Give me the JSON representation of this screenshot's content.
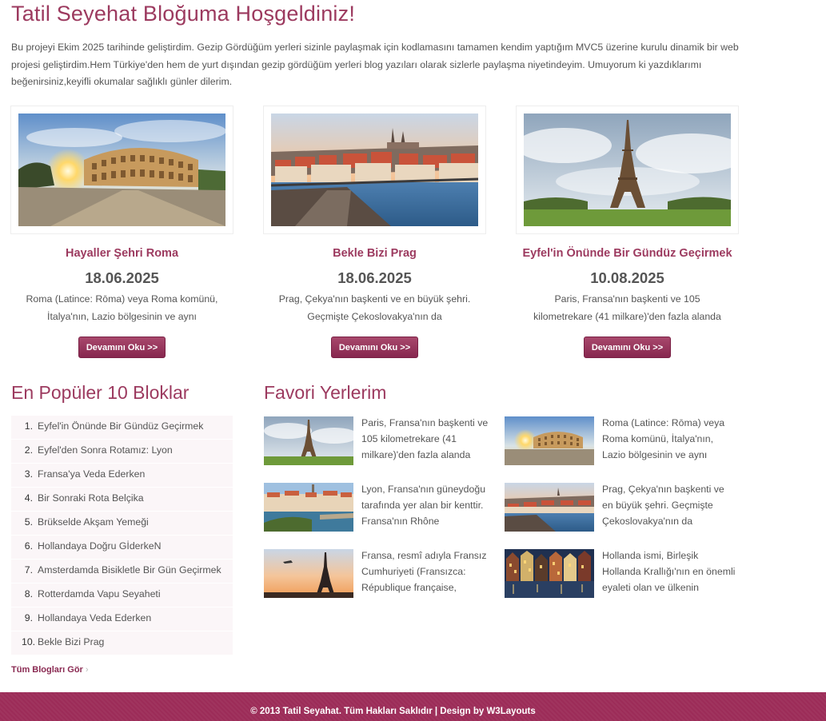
{
  "page": {
    "title": "Tatil Seyehat Bloğuma Hoşgeldiniz!",
    "intro": "Bu projeyi Ekim 2025 tarihinde geliştirdim. Gezip Gördüğüm yerleri sizinle paylaşmak için kodlamasını tamamen kendim yaptığım MVC5 üzerine kurulu dinamik bir web projesi geliştirdim.Hem Türkiye'den hem de yurt dışından gezip gördüğüm yerleri blog yazıları olarak sizlerle paylaşma niyetindeyim. Umuyorum ki yazdıklarımı beğenirsiniz,keyifli okumalar sağlıklı günler dilerim."
  },
  "featured": [
    {
      "title": "Hayaller Şehri Roma",
      "date": "18.06.2025",
      "excerpt": "Roma (Latince: Rōma) veya Roma komünü, İtalya'nın, Lazio bölgesinin ve aynı",
      "button": "Devamını Oku >>",
      "image": "colosseum-photo"
    },
    {
      "title": "Bekle Bizi Prag",
      "date": "18.06.2025",
      "excerpt": "Prag, Çekya'nın başkenti ve en büyük şehri. Geçmişte Çekoslovakya'nın da",
      "button": "Devamını Oku >>",
      "image": "prague-photo"
    },
    {
      "title": "Eyfel'in Önünde Bir Gündüz Geçirmek",
      "date": "10.08.2025",
      "excerpt": "Paris, Fransa'nın başkenti ve 105 kilometrekare (41 milkare)'den fazla alanda",
      "button": "Devamını Oku >>",
      "image": "eiffel-photo"
    }
  ],
  "popular": {
    "heading": "En Popüler 10 Bloklar",
    "items": [
      {
        "num": "1.",
        "label": "Eyfel'in Önünde Bir Gündüz Geçirmek"
      },
      {
        "num": "2.",
        "label": "Eyfel'den Sonra Rotamız: Lyon"
      },
      {
        "num": "3.",
        "label": "Fransa'ya Veda Ederken"
      },
      {
        "num": "4.",
        "label": "Bir Sonraki Rota Belçika"
      },
      {
        "num": "5.",
        "label": "Brükselde Akşam Yemeği"
      },
      {
        "num": "6.",
        "label": "Hollandaya Doğru GİderkeN"
      },
      {
        "num": "7.",
        "label": "Amsterdamda Bisikletle Bir Gün Geçirmek"
      },
      {
        "num": "8.",
        "label": "Rotterdamda Vapu Seyaheti"
      },
      {
        "num": "9.",
        "label": "Hollandaya Veda Ederken"
      },
      {
        "num": "10.",
        "label": "Bekle Bizi Prag"
      }
    ],
    "all_link": "Tüm Blogları Gör"
  },
  "favorites": {
    "heading": "Favori Yerlerim",
    "items": [
      {
        "text": "Paris, Fransa'nın başkenti ve 105 kilometrekare (41 milkare)'den fazla alanda",
        "image": "eiffel-thumb"
      },
      {
        "text": "Roma (Latince: Rōma) veya Roma komünü, İtalya'nın, Lazio bölgesinin ve aynı",
        "image": "colosseum-thumb"
      },
      {
        "text": "Lyon, Fransa'nın güneydoğu tarafında yer alan bir kenttir. Fransa'nın Rhône",
        "image": "lyon-thumb"
      },
      {
        "text": "Prag, Çekya'nın başkenti ve en büyük şehri. Geçmişte Çekoslovakya'nın da",
        "image": "prague-thumb"
      },
      {
        "text": "Fransa, resmî adıyla Fransız Cumhuriyeti (Fransızca: République française,",
        "image": "eiffel-sunset-thumb"
      },
      {
        "text": "Hollanda ismi, Birleşik Hollanda Krallığı'nın en önemli eyaleti olan ve ülkenin",
        "image": "amsterdam-thumb"
      }
    ]
  },
  "footer": {
    "text": "© 2013 Tatil Seyahat. Tüm Hakları Saklıdır | Design by W3Layouts"
  },
  "colors": {
    "accent": "#9c3a5f",
    "button": "#93305a",
    "footer": "#9c2c58",
    "list_bg": "#fbf6f8"
  }
}
